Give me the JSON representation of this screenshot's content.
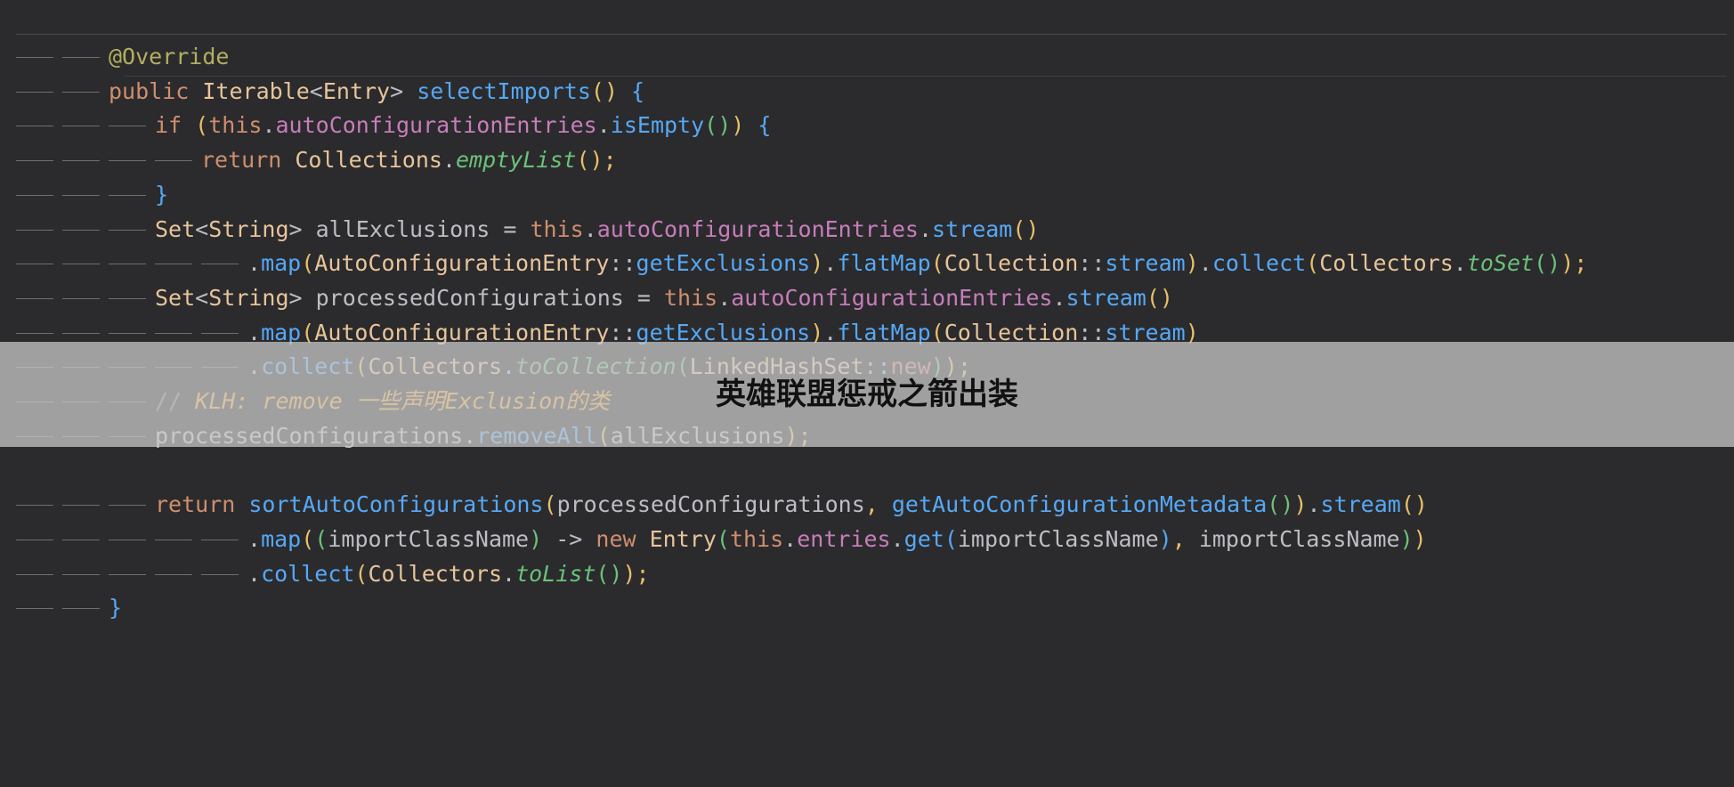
{
  "editor": {
    "theme": "dark",
    "colors": {
      "background": "#2b2b2d",
      "keyword": "#cf8e6d",
      "annotation": "#b3ae60",
      "method": "#56a8f5",
      "field": "#c77dbb",
      "static_method": "#6bc27a",
      "comment": "#7a7e85",
      "todo_comment": "#f2a93b"
    },
    "lines": [
      {
        "indent": 2,
        "tokens": [
          {
            "t": "@Override",
            "c": "anno"
          }
        ]
      },
      {
        "indent": 2,
        "tokens": [
          {
            "t": "public ",
            "c": "kw"
          },
          {
            "t": "Iterable",
            "c": "typ"
          },
          {
            "t": "<",
            "c": "pun"
          },
          {
            "t": "Entry",
            "c": "typ"
          },
          {
            "t": "> ",
            "c": "pun"
          },
          {
            "t": "selectImports",
            "c": "fn"
          },
          {
            "t": "() ",
            "c": "br1"
          },
          {
            "t": "{",
            "c": "br3"
          }
        ]
      },
      {
        "indent": 3,
        "tokens": [
          {
            "t": "if ",
            "c": "kw"
          },
          {
            "t": "(",
            "c": "br1"
          },
          {
            "t": "this",
            "c": "kw"
          },
          {
            "t": ".",
            "c": "pun"
          },
          {
            "t": "autoConfigurationEntries",
            "c": "fld"
          },
          {
            "t": ".",
            "c": "pun"
          },
          {
            "t": "isEmpty",
            "c": "fn"
          },
          {
            "t": "()",
            "c": "br2"
          },
          {
            "t": ") ",
            "c": "br1"
          },
          {
            "t": "{",
            "c": "br3"
          }
        ]
      },
      {
        "indent": 4,
        "tokens": [
          {
            "t": "return ",
            "c": "kw"
          },
          {
            "t": "Collections",
            "c": "typ"
          },
          {
            "t": ".",
            "c": "pun"
          },
          {
            "t": "emptyList",
            "c": "stat"
          },
          {
            "t": "()",
            "c": "br1"
          },
          {
            "t": ";",
            "c": "semi"
          }
        ]
      },
      {
        "indent": 3,
        "tokens": [
          {
            "t": "}",
            "c": "br3"
          }
        ]
      },
      {
        "indent": 3,
        "tokens": [
          {
            "t": "Set",
            "c": "typ"
          },
          {
            "t": "<",
            "c": "pun"
          },
          {
            "t": "String",
            "c": "typ"
          },
          {
            "t": "> allExclusions = ",
            "c": "pun"
          },
          {
            "t": "this",
            "c": "kw"
          },
          {
            "t": ".",
            "c": "pun"
          },
          {
            "t": "autoConfigurationEntries",
            "c": "fld"
          },
          {
            "t": ".",
            "c": "pun"
          },
          {
            "t": "stream",
            "c": "fn"
          },
          {
            "t": "()",
            "c": "br1"
          }
        ]
      },
      {
        "indent": 5,
        "tokens": [
          {
            "t": ".",
            "c": "pun"
          },
          {
            "t": "map",
            "c": "fn"
          },
          {
            "t": "(",
            "c": "br1"
          },
          {
            "t": "AutoConfigurationEntry",
            "c": "typ"
          },
          {
            "t": "::",
            "c": "pun"
          },
          {
            "t": "getExclusions",
            "c": "fn"
          },
          {
            "t": ")",
            "c": "br1"
          },
          {
            "t": ".",
            "c": "pun"
          },
          {
            "t": "flatMap",
            "c": "fn"
          },
          {
            "t": "(",
            "c": "br1"
          },
          {
            "t": "Collection",
            "c": "typ"
          },
          {
            "t": "::",
            "c": "pun"
          },
          {
            "t": "stream",
            "c": "fn"
          },
          {
            "t": ")",
            "c": "br1"
          },
          {
            "t": ".",
            "c": "pun"
          },
          {
            "t": "collect",
            "c": "fn"
          },
          {
            "t": "(",
            "c": "br1"
          },
          {
            "t": "Collectors",
            "c": "typ"
          },
          {
            "t": ".",
            "c": "pun"
          },
          {
            "t": "toSet",
            "c": "stat"
          },
          {
            "t": "()",
            "c": "br2"
          },
          {
            "t": ")",
            "c": "br1"
          },
          {
            "t": ";",
            "c": "semi"
          }
        ]
      },
      {
        "indent": 3,
        "tokens": [
          {
            "t": "Set",
            "c": "typ"
          },
          {
            "t": "<",
            "c": "pun"
          },
          {
            "t": "String",
            "c": "typ"
          },
          {
            "t": "> processedConfigurations = ",
            "c": "pun"
          },
          {
            "t": "this",
            "c": "kw"
          },
          {
            "t": ".",
            "c": "pun"
          },
          {
            "t": "autoConfigurationEntries",
            "c": "fld"
          },
          {
            "t": ".",
            "c": "pun"
          },
          {
            "t": "stream",
            "c": "fn"
          },
          {
            "t": "()",
            "c": "br1"
          }
        ]
      },
      {
        "indent": 5,
        "tokens": [
          {
            "t": ".",
            "c": "pun"
          },
          {
            "t": "map",
            "c": "fn"
          },
          {
            "t": "(",
            "c": "br1"
          },
          {
            "t": "AutoConfigurationEntry",
            "c": "typ"
          },
          {
            "t": "::",
            "c": "pun"
          },
          {
            "t": "getExclusions",
            "c": "fn"
          },
          {
            "t": ")",
            "c": "br1"
          },
          {
            "t": ".",
            "c": "pun"
          },
          {
            "t": "flatMap",
            "c": "fn"
          },
          {
            "t": "(",
            "c": "br1"
          },
          {
            "t": "Collection",
            "c": "typ"
          },
          {
            "t": "::",
            "c": "pun"
          },
          {
            "t": "stream",
            "c": "fn"
          },
          {
            "t": ")",
            "c": "br1"
          }
        ]
      },
      {
        "indent": 5,
        "tokens": [
          {
            "t": ".",
            "c": "pun"
          },
          {
            "t": "collect",
            "c": "fn"
          },
          {
            "t": "(",
            "c": "br1"
          },
          {
            "t": "Collectors",
            "c": "typ"
          },
          {
            "t": ".",
            "c": "pun"
          },
          {
            "t": "toCollection",
            "c": "stat"
          },
          {
            "t": "(",
            "c": "br2"
          },
          {
            "t": "LinkedHashSet",
            "c": "typ"
          },
          {
            "t": "::",
            "c": "pun"
          },
          {
            "t": "new",
            "c": "kw"
          },
          {
            "t": ")",
            "c": "br2"
          },
          {
            "t": ")",
            "c": "br1"
          },
          {
            "t": ";",
            "c": "semi"
          }
        ]
      },
      {
        "indent": 3,
        "tokens": [
          {
            "t": "// ",
            "c": "cmt"
          },
          {
            "t": "KLH: remove 一些声明Exclusion的类",
            "c": "todo"
          }
        ]
      },
      {
        "indent": 3,
        "tokens": [
          {
            "t": "processedConfigurations",
            "c": "pun"
          },
          {
            "t": ".",
            "c": "pun"
          },
          {
            "t": "removeAll",
            "c": "fn"
          },
          {
            "t": "(",
            "c": "br1"
          },
          {
            "t": "allExclusions",
            "c": "pun"
          },
          {
            "t": ")",
            "c": "br1"
          },
          {
            "t": ";",
            "c": "semi"
          }
        ]
      },
      {
        "indent": 0,
        "tokens": []
      },
      {
        "indent": 3,
        "tokens": [
          {
            "t": "return ",
            "c": "kw"
          },
          {
            "t": "sortAutoConfigurations",
            "c": "fn"
          },
          {
            "t": "(",
            "c": "br1"
          },
          {
            "t": "processedConfigurations",
            "c": "pun"
          },
          {
            "t": ", ",
            "c": "semi"
          },
          {
            "t": "getAutoConfigurationMetadata",
            "c": "fn"
          },
          {
            "t": "()",
            "c": "br2"
          },
          {
            "t": ")",
            "c": "br1"
          },
          {
            "t": ".",
            "c": "pun"
          },
          {
            "t": "stream",
            "c": "fn"
          },
          {
            "t": "()",
            "c": "br1"
          }
        ]
      },
      {
        "indent": 5,
        "tokens": [
          {
            "t": ".",
            "c": "pun"
          },
          {
            "t": "map",
            "c": "fn"
          },
          {
            "t": "(",
            "c": "br1"
          },
          {
            "t": "(",
            "c": "br2"
          },
          {
            "t": "importClassName",
            "c": "pun"
          },
          {
            "t": ")",
            "c": "br2"
          },
          {
            "t": " -> ",
            "c": "pun"
          },
          {
            "t": "new ",
            "c": "kw"
          },
          {
            "t": "Entry",
            "c": "typ"
          },
          {
            "t": "(",
            "c": "br2"
          },
          {
            "t": "this",
            "c": "kw"
          },
          {
            "t": ".",
            "c": "pun"
          },
          {
            "t": "entries",
            "c": "fld"
          },
          {
            "t": ".",
            "c": "pun"
          },
          {
            "t": "get",
            "c": "fn"
          },
          {
            "t": "(",
            "c": "br3"
          },
          {
            "t": "importClassName",
            "c": "pun"
          },
          {
            "t": ")",
            "c": "br3"
          },
          {
            "t": ", ",
            "c": "semi"
          },
          {
            "t": "importClassName",
            "c": "pun"
          },
          {
            "t": ")",
            "c": "br2"
          },
          {
            "t": ")",
            "c": "br1"
          }
        ]
      },
      {
        "indent": 5,
        "tokens": [
          {
            "t": ".",
            "c": "pun"
          },
          {
            "t": "collect",
            "c": "fn"
          },
          {
            "t": "(",
            "c": "br1"
          },
          {
            "t": "Collectors",
            "c": "typ"
          },
          {
            "t": ".",
            "c": "pun"
          },
          {
            "t": "toList",
            "c": "stat"
          },
          {
            "t": "()",
            "c": "br2"
          },
          {
            "t": ")",
            "c": "br1"
          },
          {
            "t": ";",
            "c": "semi"
          }
        ]
      },
      {
        "indent": 2,
        "tokens": [
          {
            "t": "}",
            "c": "br3"
          }
        ]
      }
    ]
  },
  "overlay": {
    "caption": "英雄联盟惩戒之箭出装"
  }
}
